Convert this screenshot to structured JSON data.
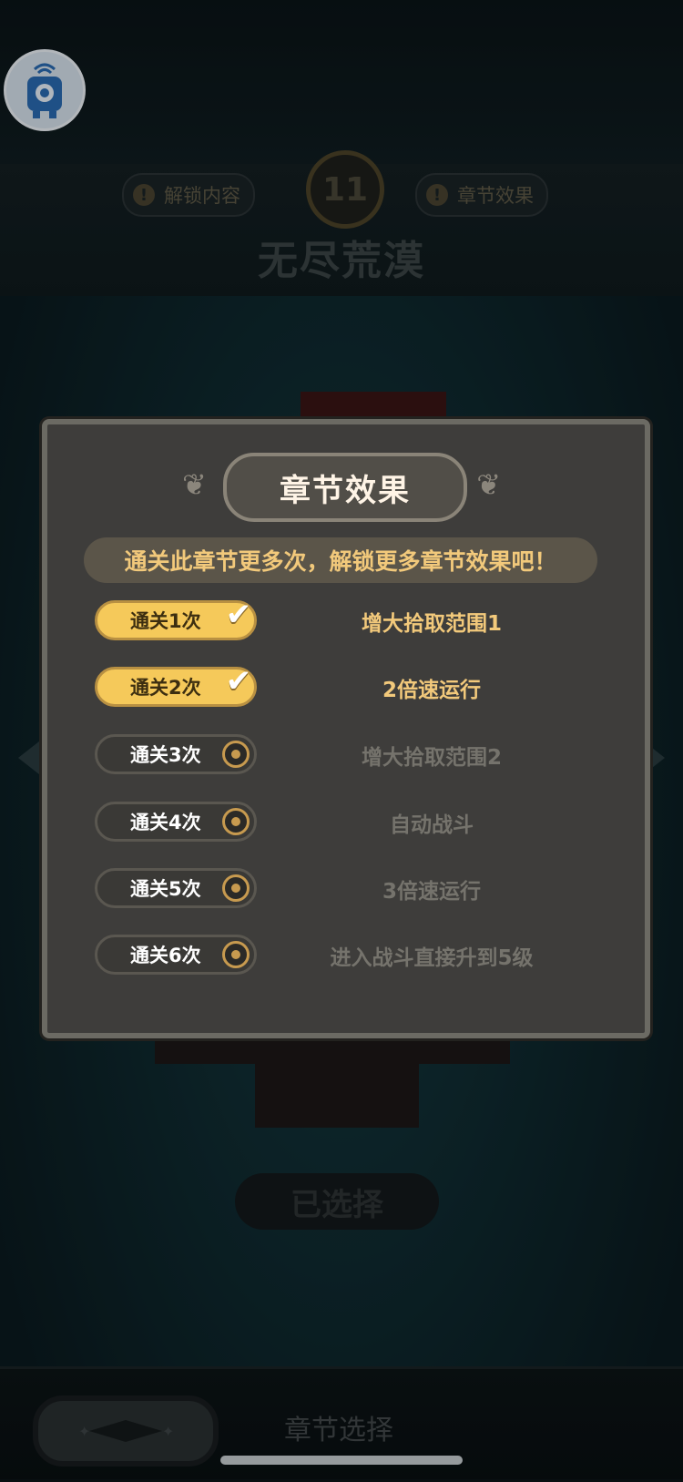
{
  "header": {
    "left_chip": "解锁内容",
    "right_chip": "章节效果",
    "level": "11",
    "chapter_title": "无尽荒漠"
  },
  "panel": {
    "title": "章节效果",
    "subtitle": "通关此章节更多次，解锁更多章节效果吧！",
    "rows": [
      {
        "label": "通关1次",
        "effect": "增大拾取范围1",
        "status": "completed"
      },
      {
        "label": "通关2次",
        "effect": "2倍速运行",
        "status": "completed"
      },
      {
        "label": "通关3次",
        "effect": "增大拾取范围2",
        "status": "locked"
      },
      {
        "label": "通关4次",
        "effect": "自动战斗",
        "status": "locked"
      },
      {
        "label": "通关5次",
        "effect": "3倍速运行",
        "status": "locked"
      },
      {
        "label": "通关6次",
        "effect": "进入战斗直接升到5级",
        "status": "locked"
      }
    ]
  },
  "selected_button": "已选择",
  "bottom": {
    "label": "章节选择"
  },
  "icons": {
    "avatar": "robot-avatar-icon",
    "check": "check-icon",
    "ring": "ring-icon",
    "warning": "warning-icon"
  },
  "colors": {
    "gold": "#f5c95a",
    "panel_bg": "#3e3d3b",
    "text_gold": "#f2c97b"
  }
}
